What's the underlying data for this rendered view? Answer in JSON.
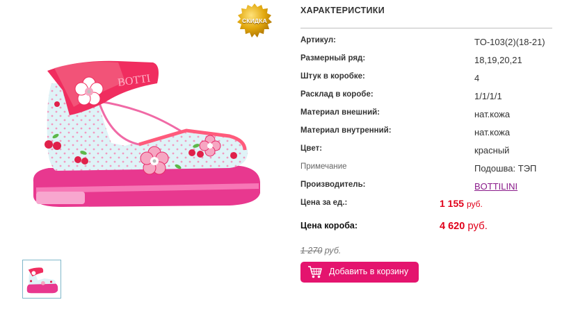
{
  "badge": {
    "label": "СКИДКА"
  },
  "specs": {
    "title": "ХАРАКТЕРИСТИКИ",
    "rows": [
      {
        "label": "Артикул:",
        "value": "TO-103(2)(18-21)"
      },
      {
        "label": "Размерный ряд:",
        "value": "18,19,20,21"
      },
      {
        "label": "Штук в коробке:",
        "value": "4"
      },
      {
        "label": "Расклад в коробе:",
        "value": "1/1/1/1"
      },
      {
        "label": "Материал внешний:",
        "value": "нат.кожа"
      },
      {
        "label": "Материал внутренний:",
        "value": "нат.кожа"
      },
      {
        "label": "Цвет:",
        "value": "красный"
      },
      {
        "label": "Примечание",
        "value": "Подошва: ТЭП"
      },
      {
        "label": "Производитель:",
        "value": "BOTTILINI"
      }
    ]
  },
  "price": {
    "unit_label": "Цена за ед.:",
    "unit_value": "1 155",
    "unit_currency": "руб.",
    "box_label": "Цена короба:",
    "box_value": "4 620",
    "box_currency": "руб.",
    "old_value": "1 270",
    "old_currency": "руб."
  },
  "actions": {
    "add_to_cart": "Добавить в корзину"
  },
  "colors": {
    "accent": "#e4146e",
    "price": "#e0001a",
    "link": "#8a1a8a",
    "badge": "#d9a200"
  },
  "icons": {
    "cart": "shopping-cart-icon",
    "badge": "sale-badge-icon"
  }
}
